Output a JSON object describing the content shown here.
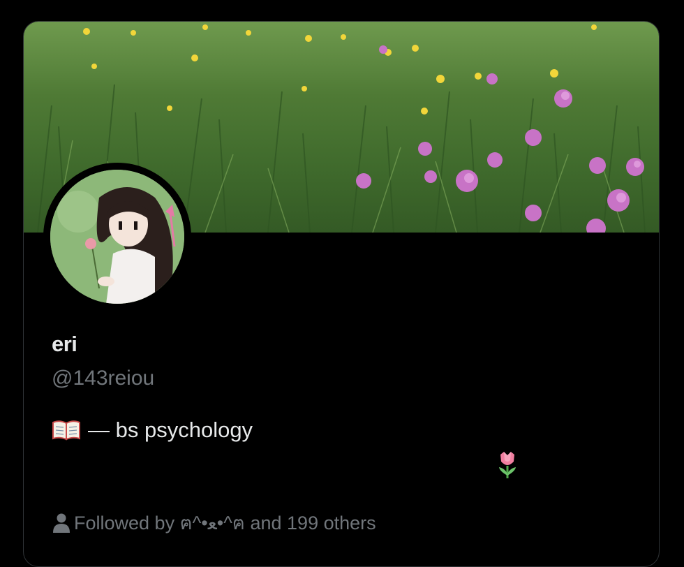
{
  "profile": {
    "display_name": "eri",
    "handle": "@143reiou",
    "bio_text": "— bs psychology",
    "bio_icon": "open-book-icon",
    "bio_trailing_icon": "tulip-icon",
    "followed_by_text": "Followed by ฅ^•ﻌ•^ฅ and 199 others",
    "followed_icon": "person-icon"
  },
  "banner": {
    "description_icon": "meadow-banner-image"
  },
  "avatar": {
    "icon": "avatar-image"
  },
  "colors": {
    "background": "#000000",
    "primary_text": "#e7e9ea",
    "secondary_text": "#71767b",
    "border": "#2f3336"
  }
}
